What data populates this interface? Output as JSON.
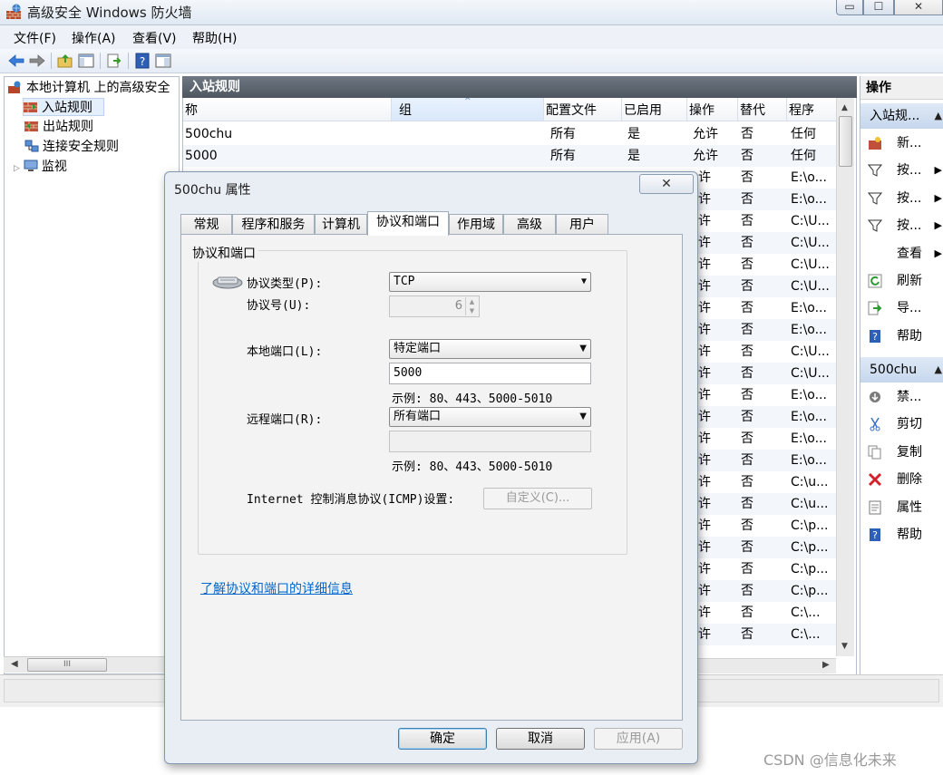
{
  "window": {
    "title": "高级安全 Windows 防火墙",
    "min": "▭",
    "max": "☐",
    "close": "✕"
  },
  "menu": [
    "文件(F)",
    "操作(A)",
    "查看(V)",
    "帮助(H)"
  ],
  "tree": {
    "root": "本地计算机 上的高级安全",
    "items": [
      "入站规则",
      "出站规则",
      "连接安全规则",
      "监视"
    ],
    "scroll_grip": "III"
  },
  "rules_pane": {
    "title": "入站规则",
    "columns": [
      "称",
      "组",
      "配置文件",
      "已启用",
      "操作",
      "替代",
      "程序"
    ],
    "rows": [
      [
        "500chu",
        "所有",
        "是",
        "允许",
        "否",
        "任何"
      ],
      [
        "5000",
        "所有",
        "是",
        "允许",
        "否",
        "任何"
      ],
      [
        "",
        "",
        "",
        "许",
        "否",
        "E:\\o..."
      ],
      [
        "",
        "",
        "",
        "许",
        "否",
        "E:\\o..."
      ],
      [
        "",
        "",
        "",
        "许",
        "否",
        "C:\\U..."
      ],
      [
        "",
        "",
        "",
        "许",
        "否",
        "C:\\U..."
      ],
      [
        "",
        "",
        "",
        "许",
        "否",
        "C:\\U..."
      ],
      [
        "",
        "",
        "",
        "许",
        "否",
        "C:\\U..."
      ],
      [
        "",
        "",
        "",
        "许",
        "否",
        "E:\\o..."
      ],
      [
        "",
        "",
        "",
        "许",
        "否",
        "E:\\o..."
      ],
      [
        "",
        "",
        "",
        "许",
        "否",
        "C:\\U..."
      ],
      [
        "",
        "",
        "",
        "许",
        "否",
        "C:\\U..."
      ],
      [
        "",
        "",
        "",
        "许",
        "否",
        "E:\\o..."
      ],
      [
        "",
        "",
        "",
        "许",
        "否",
        "E:\\o..."
      ],
      [
        "",
        "",
        "",
        "许",
        "否",
        "E:\\o..."
      ],
      [
        "",
        "",
        "",
        "许",
        "否",
        "E:\\o..."
      ],
      [
        "",
        "",
        "",
        "许",
        "否",
        "C:\\u..."
      ],
      [
        "",
        "",
        "",
        "许",
        "否",
        "C:\\u..."
      ],
      [
        "",
        "",
        "",
        "许",
        "否",
        "C:\\p..."
      ],
      [
        "",
        "",
        "",
        "许",
        "否",
        "C:\\p..."
      ],
      [
        "",
        "",
        "",
        "许",
        "否",
        "C:\\p..."
      ],
      [
        "",
        "",
        "",
        "许",
        "否",
        "C:\\p..."
      ],
      [
        "",
        "",
        "",
        "许",
        "否",
        "C:\\..."
      ],
      [
        "",
        "",
        "",
        "许",
        "否",
        "C:\\..."
      ]
    ]
  },
  "actions": {
    "title": "操作",
    "section1": "入站规...",
    "section1_items": [
      {
        "label": "新...",
        "icon": "new-rule-icon",
        "submenu": false
      },
      {
        "label": "按...",
        "icon": "filter-icon",
        "submenu": true
      },
      {
        "label": "按...",
        "icon": "filter-icon",
        "submenu": true
      },
      {
        "label": "按...",
        "icon": "filter-icon",
        "submenu": true
      },
      {
        "label": "查看",
        "icon": "view-icon",
        "submenu": true
      },
      {
        "label": "刷新",
        "icon": "refresh-icon",
        "submenu": false
      },
      {
        "label": "导...",
        "icon": "export-icon",
        "submenu": false
      },
      {
        "label": "帮助",
        "icon": "help-icon",
        "submenu": false
      }
    ],
    "section2": "500chu",
    "section2_items": [
      {
        "label": "禁...",
        "icon": "disable-icon"
      },
      {
        "label": "剪切",
        "icon": "cut-icon"
      },
      {
        "label": "复制",
        "icon": "copy-icon"
      },
      {
        "label": "删除",
        "icon": "delete-icon"
      },
      {
        "label": "属性",
        "icon": "properties-icon"
      },
      {
        "label": "帮助",
        "icon": "help-icon"
      }
    ]
  },
  "dialog": {
    "title": "500chu 属性",
    "close": "✕",
    "tabs": [
      "常规",
      "程序和服务",
      "计算机",
      "协议和端口",
      "作用域",
      "高级",
      "用户"
    ],
    "active_tab": "协议和端口",
    "group_title": "协议和端口",
    "protocol_type_label": "协议类型(P):",
    "protocol_type_value": "TCP",
    "protocol_number_label": "协议号(U):",
    "protocol_number_value": "6",
    "local_port_label": "本地端口(L):",
    "local_port_mode": "特定端口",
    "local_port_value": "5000",
    "local_port_example": "示例: 80、443、5000-5010",
    "remote_port_label": "远程端口(R):",
    "remote_port_mode": "所有端口",
    "remote_port_value": "",
    "remote_port_example": "示例: 80、443、5000-5010",
    "icmp_label": "Internet 控制消息协议(ICMP)设置:",
    "icmp_button": "自定义(C)...",
    "learn_more_link": "了解协议和端口的详细信息",
    "ok": "确定",
    "cancel": "取消",
    "apply": "应用(A)"
  },
  "watermark": "CSDN @信息化未来"
}
